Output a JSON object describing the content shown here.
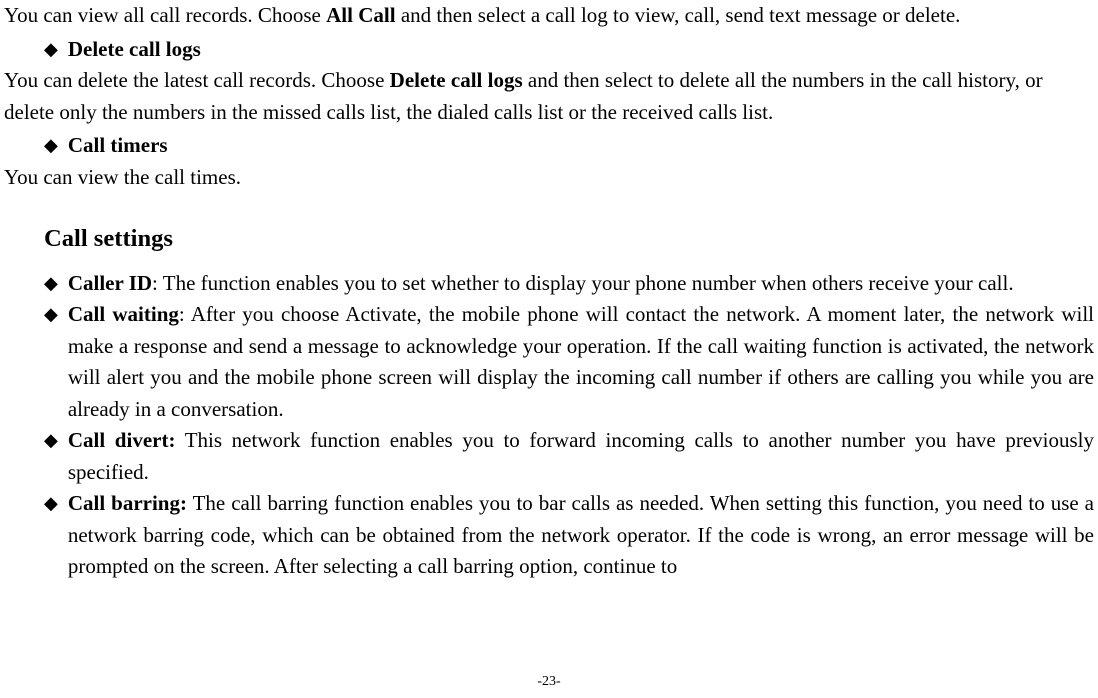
{
  "intro": {
    "prefix": "You can view all call records. Choose ",
    "bold": "All Call",
    "suffix": " and then select a call log to view, call, send text message or delete."
  },
  "deleteCallLogs": {
    "heading": "Delete call logs",
    "prefix": "You can delete the latest call records. Choose ",
    "bold": "Delete call logs",
    "suffix": " and then select to delete all the numbers in the call history, or delete only the numbers in the missed calls list, the dialed calls list or the received calls list."
  },
  "callTimers": {
    "heading": "Call timers",
    "text": "You can view the call times."
  },
  "callSettings": {
    "heading": "Call settings"
  },
  "callerId": {
    "bold": "Caller ID",
    "text": ": The function enables you to set whether to display your phone number when others receive your call."
  },
  "callWaiting": {
    "bold": "Call waiting",
    "text": ": After you choose Activate, the mobile phone will contact the network. A moment later, the network will make a response and send a message to acknowledge your operation. If the call waiting function is activated, the network will alert you and the mobile phone screen will display the incoming call number if others are calling you while you are already in a conversation."
  },
  "callDivert": {
    "bold": "Call divert:",
    "text": " This network function enables you to forward incoming calls to another number you have previously specified."
  },
  "callBarring": {
    "bold": "Call barring:",
    "text": " The call barring function enables you to bar calls as needed. When setting this function, you need to use a network barring code, which can be obtained from the network operator. If the code is wrong, an error message will be prompted on the screen. After selecting a call barring option, continue to"
  },
  "pageNumber": "-23-"
}
